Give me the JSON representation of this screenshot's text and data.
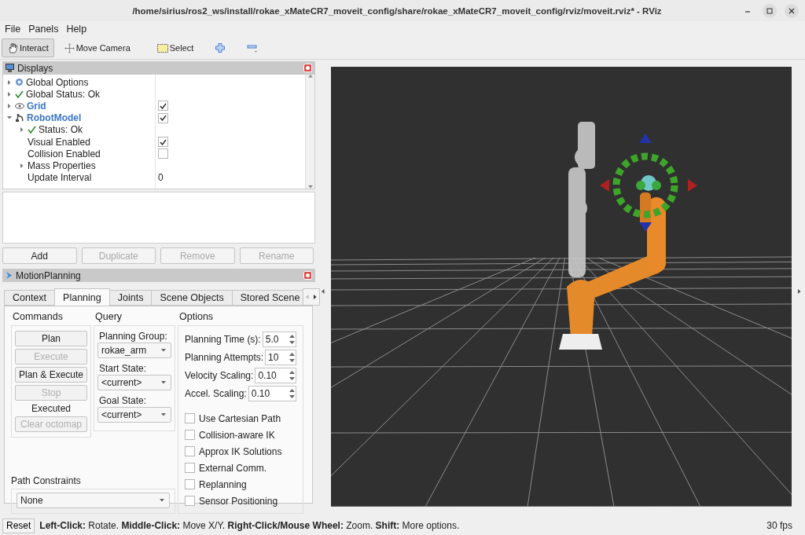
{
  "window": {
    "title": "/home/sirius/ros2_ws/install/rokae_xMateCR7_moveit_config/share/rokae_xMateCR7_moveit_config/rviz/moveit.rviz* - RViz"
  },
  "menu": [
    "File",
    "Panels",
    "Help"
  ],
  "toolbar": [
    {
      "kind": "interact",
      "label": "Interact",
      "selected": true
    },
    {
      "kind": "move-camera",
      "label": "Move Camera",
      "selected": false
    },
    {
      "kind": "select",
      "label": "Select",
      "selected": false
    },
    {
      "kind": "add-tool"
    },
    {
      "kind": "remove-tool"
    }
  ],
  "displays": {
    "title": "Displays",
    "tree": [
      {
        "kind": "options",
        "label": "Global Options",
        "expanded": false
      },
      {
        "kind": "status",
        "label": "Global Status: Ok",
        "expanded": false
      },
      {
        "kind": "grid",
        "label": "Grid",
        "expanded": false,
        "checked": true
      },
      {
        "kind": "robot",
        "label": "RobotModel",
        "expanded": true,
        "checked": true,
        "children": [
          {
            "kind": "status",
            "label": "Status: Ok",
            "expanded": false
          },
          {
            "kind": "property",
            "label": "Visual Enabled",
            "checked": true
          },
          {
            "kind": "property",
            "label": "Collision Enabled",
            "checked": false
          },
          {
            "kind": "property",
            "label": "Mass Properties",
            "expanded": false
          },
          {
            "kind": "property",
            "label": "Update Interval",
            "value": "0"
          }
        ]
      }
    ],
    "buttons": [
      {
        "label": "Add",
        "disabled": false
      },
      {
        "label": "Duplicate",
        "disabled": true
      },
      {
        "label": "Remove",
        "disabled": true
      },
      {
        "label": "Rename",
        "disabled": true
      }
    ]
  },
  "motion_planning": {
    "title": "MotionPlanning",
    "tabs": [
      {
        "label": "Context",
        "selected": false
      },
      {
        "label": "Planning",
        "selected": true
      },
      {
        "label": "Joints",
        "selected": false
      },
      {
        "label": "Scene Objects",
        "selected": false
      },
      {
        "label": "Stored Scene",
        "selected": false
      }
    ],
    "commands": {
      "heading": "Commands",
      "items": [
        {
          "kind": "button",
          "label": "Plan",
          "disabled": false
        },
        {
          "kind": "button",
          "label": "Execute",
          "disabled": true
        },
        {
          "kind": "button",
          "label": "Plan & Execute",
          "disabled": false
        },
        {
          "kind": "button",
          "label": "Stop",
          "disabled": true
        },
        {
          "kind": "label",
          "label": "Executed"
        },
        {
          "kind": "button",
          "label": "Clear octomap",
          "disabled": true
        }
      ]
    },
    "query": {
      "heading": "Query",
      "fields": [
        {
          "label": "Planning Group:",
          "value": "rokae_arm"
        },
        {
          "label": "Start State:",
          "value": "<current>"
        },
        {
          "label": "Goal State:",
          "value": "<current>"
        }
      ]
    },
    "options": {
      "heading": "Options",
      "spins": [
        {
          "label": "Planning Time (s):",
          "value": "5.0"
        },
        {
          "label": "Planning Attempts:",
          "value": "10"
        },
        {
          "label": "Velocity Scaling:",
          "value": "0.10"
        },
        {
          "label": "Accel. Scaling:",
          "value": "0.10"
        }
      ],
      "checks": [
        {
          "label": "Use Cartesian Path",
          "checked": false
        },
        {
          "label": "Collision-aware IK",
          "checked": false
        },
        {
          "label": "Approx IK Solutions",
          "checked": false
        },
        {
          "label": "External Comm.",
          "checked": false
        },
        {
          "label": "Replanning",
          "checked": false
        },
        {
          "label": "Sensor Positioning",
          "checked": false
        }
      ]
    },
    "path_constraints": {
      "label": "Path Constraints",
      "value": "None"
    }
  },
  "status_bar": {
    "reset": "Reset",
    "message": "**Left-Click:** Rotate. **Middle-Click:** Move X/Y. **Right-Click/Mouse Wheel:** Zoom. **Shift:** More options.",
    "fps": "30 fps"
  }
}
